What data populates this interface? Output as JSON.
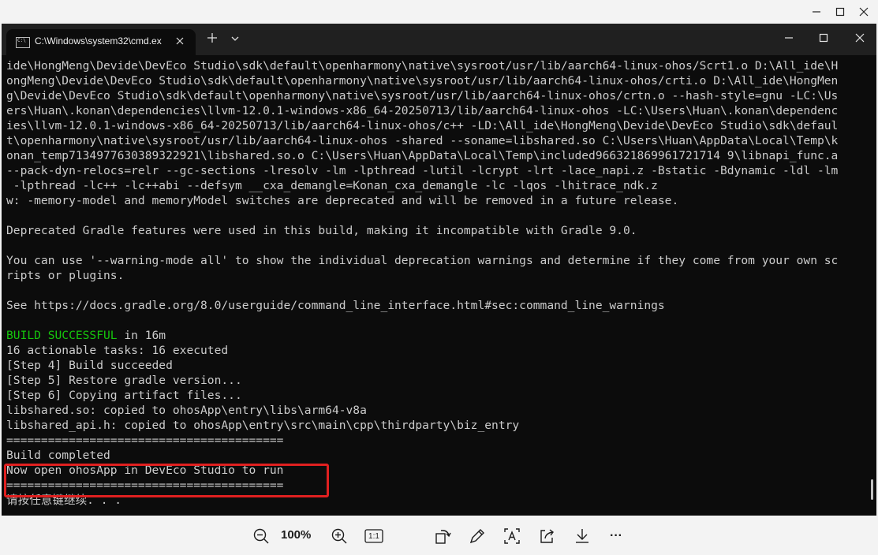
{
  "viewer": {
    "minimize_icon": "minimize-icon",
    "maximize_icon": "maximize-icon",
    "close_icon": "close-icon"
  },
  "terminal": {
    "tab_title": "C:\\Windows\\system32\\cmd.ex",
    "tab_icon": "cmd-icon",
    "lines": [
      {
        "text": "ide\\HongMeng\\Devide\\DevEco Studio\\sdk\\default\\openharmony\\native\\sysroot/usr/lib/aarch64-linux-ohos/Scrt1.o D:\\All_ide\\H",
        "color": "default"
      },
      {
        "text": "ongMeng\\Devide\\DevEco Studio\\sdk\\default\\openharmony\\native\\sysroot/usr/lib/aarch64-linux-ohos/crti.o D:\\All_ide\\HongMen",
        "color": "default"
      },
      {
        "text": "g\\Devide\\DevEco Studio\\sdk\\default\\openharmony\\native\\sysroot/usr/lib/aarch64-linux-ohos/crtn.o --hash-style=gnu -LC:\\Us",
        "color": "default"
      },
      {
        "text": "ers\\Huan\\.konan\\dependencies\\llvm-12.0.1-windows-x86_64-20250713/lib/aarch64-linux-ohos -LC:\\Users\\Huan\\.konan\\dependenc",
        "color": "default"
      },
      {
        "text": "ies\\llvm-12.0.1-windows-x86_64-20250713/lib/aarch64-linux-ohos/c++ -LD:\\All_ide\\HongMeng\\Devide\\DevEco Studio\\sdk\\defaul",
        "color": "default"
      },
      {
        "text": "t\\openharmony\\native\\sysroot/usr/lib/aarch64-linux-ohos -shared --soname=libshared.so C:\\Users\\Huan\\AppData\\Local\\Temp\\k",
        "color": "default"
      },
      {
        "text": "onan_temp7134977630389322921\\libshared.so.o C:\\Users\\Huan\\AppData\\Local\\Temp\\included966321869961721714 9\\libnapi_func.a",
        "color": "default"
      },
      {
        "text": "--pack-dyn-relocs=relr --gc-sections -lresolv -lm -lpthread -lutil -lcrypt -lrt -lace_napi.z -Bstatic -Bdynamic -ldl -lm",
        "color": "default"
      },
      {
        "text": " -lpthread -lc++ -lc++abi --defsym __cxa_demangle=Konan_cxa_demangle -lc -lqos -lhitrace_ndk.z",
        "color": "default"
      },
      {
        "text": "w: -memory-model and memoryModel switches are deprecated and will be removed in a future release.",
        "color": "default"
      },
      {
        "text": "",
        "color": "default"
      },
      {
        "text": "Deprecated Gradle features were used in this build, making it incompatible with Gradle 9.0.",
        "color": "default"
      },
      {
        "text": "",
        "color": "default"
      },
      {
        "text": "You can use '--warning-mode all' to show the individual deprecation warnings and determine if they come from your own sc",
        "color": "default"
      },
      {
        "text": "ripts or plugins.",
        "color": "default"
      },
      {
        "text": "",
        "color": "default"
      },
      {
        "text": "See https://docs.gradle.org/8.0/userguide/command_line_interface.html#sec:command_line_warnings",
        "color": "default"
      },
      {
        "text": "",
        "color": "default"
      },
      {
        "text": "",
        "color": "default",
        "green_prefix": "BUILD SUCCESSFUL",
        "suffix": " in 16m"
      },
      {
        "text": "16 actionable tasks: 16 executed",
        "color": "default"
      },
      {
        "text": "[Step 4] Build succeeded",
        "color": "default"
      },
      {
        "text": "[Step 5] Restore gradle version...",
        "color": "default"
      },
      {
        "text": "[Step 6] Copying artifact files...",
        "color": "default"
      },
      {
        "text": "libshared.so: copied to ohosApp\\entry\\libs\\arm64-v8a",
        "color": "default"
      },
      {
        "text": "libshared_api.h: copied to ohosApp\\entry\\src\\main\\cpp\\thirdparty\\biz_entry",
        "color": "default"
      },
      {
        "text": "========================================",
        "color": "default"
      },
      {
        "text": "Build completed",
        "color": "default"
      },
      {
        "text": "Now open ohosApp in DevEco Studio to run",
        "color": "default"
      },
      {
        "text": "========================================",
        "color": "default"
      },
      {
        "text": "请按任意键继续. . .",
        "color": "default"
      }
    ],
    "accent_green": "#16c60c",
    "highlight_color": "#e02020"
  },
  "toolbar": {
    "zoom_level": "100%",
    "actual_size_label": "1:1",
    "more_label": "···"
  }
}
